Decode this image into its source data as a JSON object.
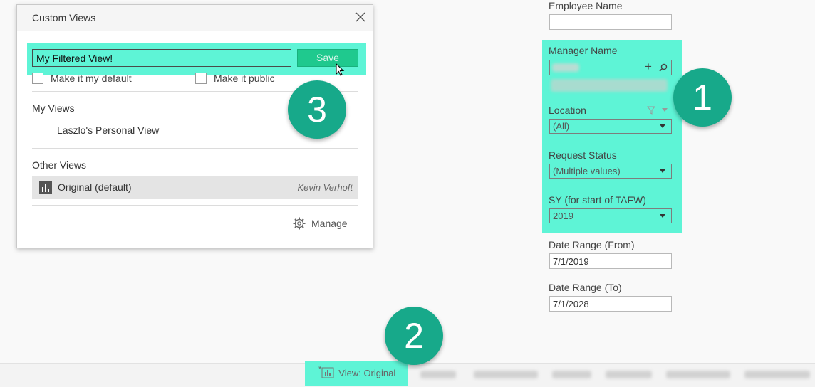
{
  "dialog": {
    "title": "Custom Views",
    "name_input_value": "My Filtered View!",
    "save_label": "Save",
    "make_default_label": "Make it my default",
    "make_public_label": "Make it public",
    "my_views_title": "My Views",
    "my_views": [
      "Laszlo's Personal View"
    ],
    "other_views_title": "Other Views",
    "other_views": [
      {
        "name": "Original (default)",
        "author": "Kevin Verhoft"
      }
    ],
    "manage_label": "Manage"
  },
  "callouts": [
    "1",
    "2",
    "3"
  ],
  "filters": {
    "employee_name_label": "Employee Name",
    "employee_name_value": "",
    "manager_name_label": "Manager Name",
    "location_label": "Location",
    "location_value": "(All)",
    "request_status_label": "Request Status",
    "request_status_value": "(Multiple values)",
    "sy_label": "SY (for start of TAFW)",
    "sy_value": "2019",
    "date_from_label": "Date Range (From)",
    "date_from_value": "7/1/2019",
    "date_to_label": "Date Range (To)",
    "date_to_value": "7/1/2028"
  },
  "toolbar": {
    "view_label": "View: Original",
    "modified_marker": "*"
  },
  "colors": {
    "highlight": "#5ef4d6",
    "callout": "#17a98a",
    "save_button": "#1fc98e"
  }
}
